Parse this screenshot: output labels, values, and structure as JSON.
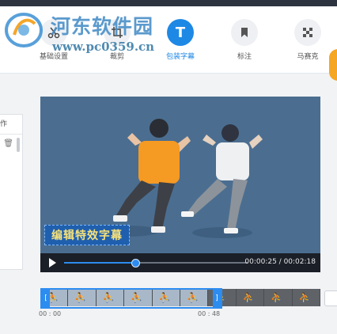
{
  "watermark": {
    "title": "河东软件园",
    "url": "www.pc0359.cn"
  },
  "toolbar": {
    "tools": [
      {
        "id": "basic",
        "label": "基础设置",
        "icon": "scissors-icon"
      },
      {
        "id": "crop",
        "label": "裁剪",
        "icon": "crop-icon"
      },
      {
        "id": "subtitle",
        "label": "包装字幕",
        "icon": "text-T-icon",
        "glyph": "T",
        "active": true
      },
      {
        "id": "mark",
        "label": "标注",
        "icon": "bookmark-icon"
      },
      {
        "id": "mosaic",
        "label": "马赛克",
        "icon": "mosaic-icon"
      }
    ]
  },
  "side_panel": {
    "header": "作"
  },
  "player": {
    "subtitle_text": "编辑特效字幕",
    "time": "00:00:25 / 00:02:18",
    "progress_fraction": 0.39
  },
  "timeline": {
    "frame_count": 10,
    "selected_frames": 6,
    "ticks": [
      {
        "label": "00 : 00"
      },
      {
        "label": "00 : 48"
      }
    ]
  },
  "colors": {
    "accent": "#2d8cf0",
    "active_tool": "#1e88e5",
    "video_bg": "#4a6b8c",
    "subtitle_text": "#f7e27a"
  }
}
